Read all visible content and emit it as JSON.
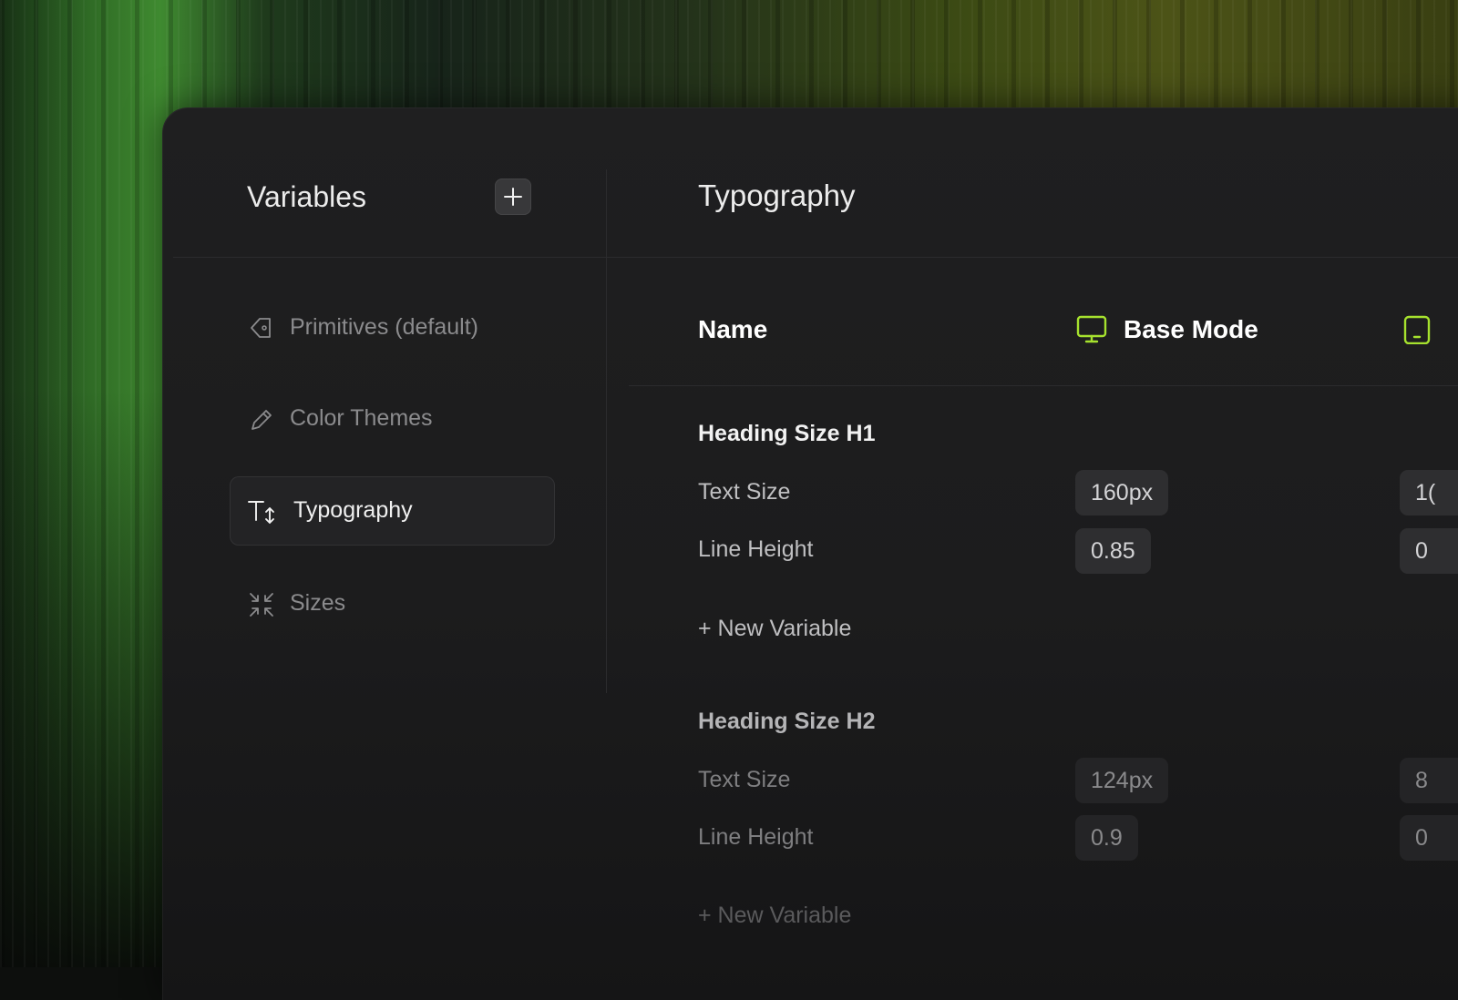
{
  "sidebar": {
    "title": "Variables",
    "add_icon": "plus-icon",
    "items": [
      {
        "label": "Primitives (default)",
        "icon": "tag-icon",
        "active": false
      },
      {
        "label": "Color Themes",
        "icon": "pencil-icon",
        "active": false
      },
      {
        "label": "Typography",
        "icon": "text-size-icon",
        "active": true
      },
      {
        "label": "Sizes",
        "icon": "collapse-arrows-icon",
        "active": false
      }
    ]
  },
  "main": {
    "title": "Typography",
    "columns": {
      "name": "Name",
      "modes": [
        {
          "label": "Base Mode",
          "icon": "desktop-monitor-icon"
        },
        {
          "label": "",
          "icon": "tablet-icon"
        }
      ]
    },
    "groups": [
      {
        "title": "Heading Size H1",
        "rows": [
          {
            "label": "Text Size",
            "values": [
              "160px",
              "1("
            ]
          },
          {
            "label": "Line Height",
            "values": [
              "0.85",
              "0"
            ]
          }
        ],
        "new_variable": "+ New Variable"
      },
      {
        "title": "Heading Size H2",
        "rows": [
          {
            "label": "Text Size",
            "values": [
              "124px",
              "8"
            ]
          },
          {
            "label": "Line Height",
            "values": [
              "0.9",
              "0"
            ]
          }
        ],
        "new_variable": "+ New Variable"
      }
    ]
  },
  "colors": {
    "accent": "#a6e22e",
    "panel": "#1e1e1f",
    "pill": "#2d2d2f"
  }
}
